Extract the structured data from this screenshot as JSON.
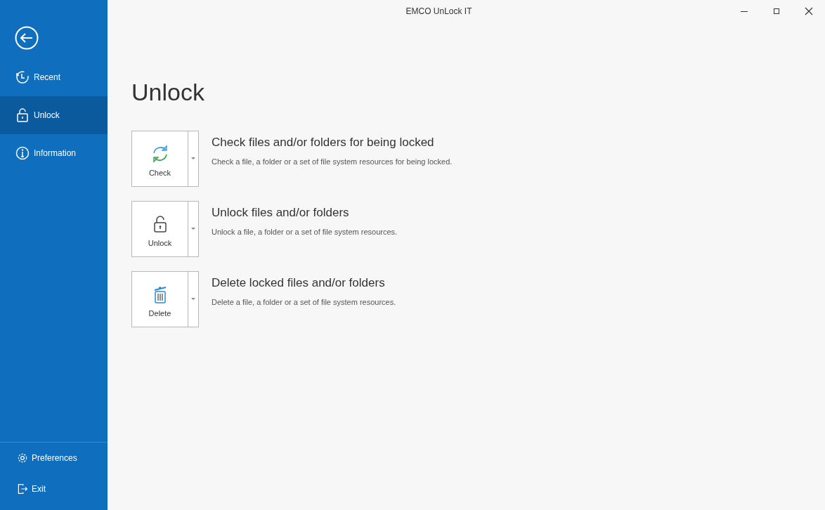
{
  "window": {
    "title": "EMCO UnLock IT"
  },
  "sidebar": {
    "items": [
      {
        "label": "Recent",
        "kind": "recent",
        "selected": false
      },
      {
        "label": "Unlock",
        "kind": "unlock",
        "selected": true
      },
      {
        "label": "Information",
        "kind": "information",
        "selected": false
      }
    ],
    "bottom_items": [
      {
        "label": "Preferences",
        "kind": "preferences"
      },
      {
        "label": "Exit",
        "kind": "exit"
      }
    ]
  },
  "page": {
    "title": "Unlock",
    "actions": [
      {
        "kind": "check",
        "button": "Check",
        "title": "Check files and/or folders for being locked",
        "description": "Check a file, a folder or a set of file system resources for being locked."
      },
      {
        "kind": "unlock",
        "button": "Unlock",
        "title": "Unlock files and/or folders",
        "description": "Unlock a file, a folder or a set of file system resources."
      },
      {
        "kind": "delete",
        "button": "Delete",
        "title": "Delete locked files and/or folders",
        "description": "Delete a file, a folder or a set of file system resources."
      }
    ]
  }
}
